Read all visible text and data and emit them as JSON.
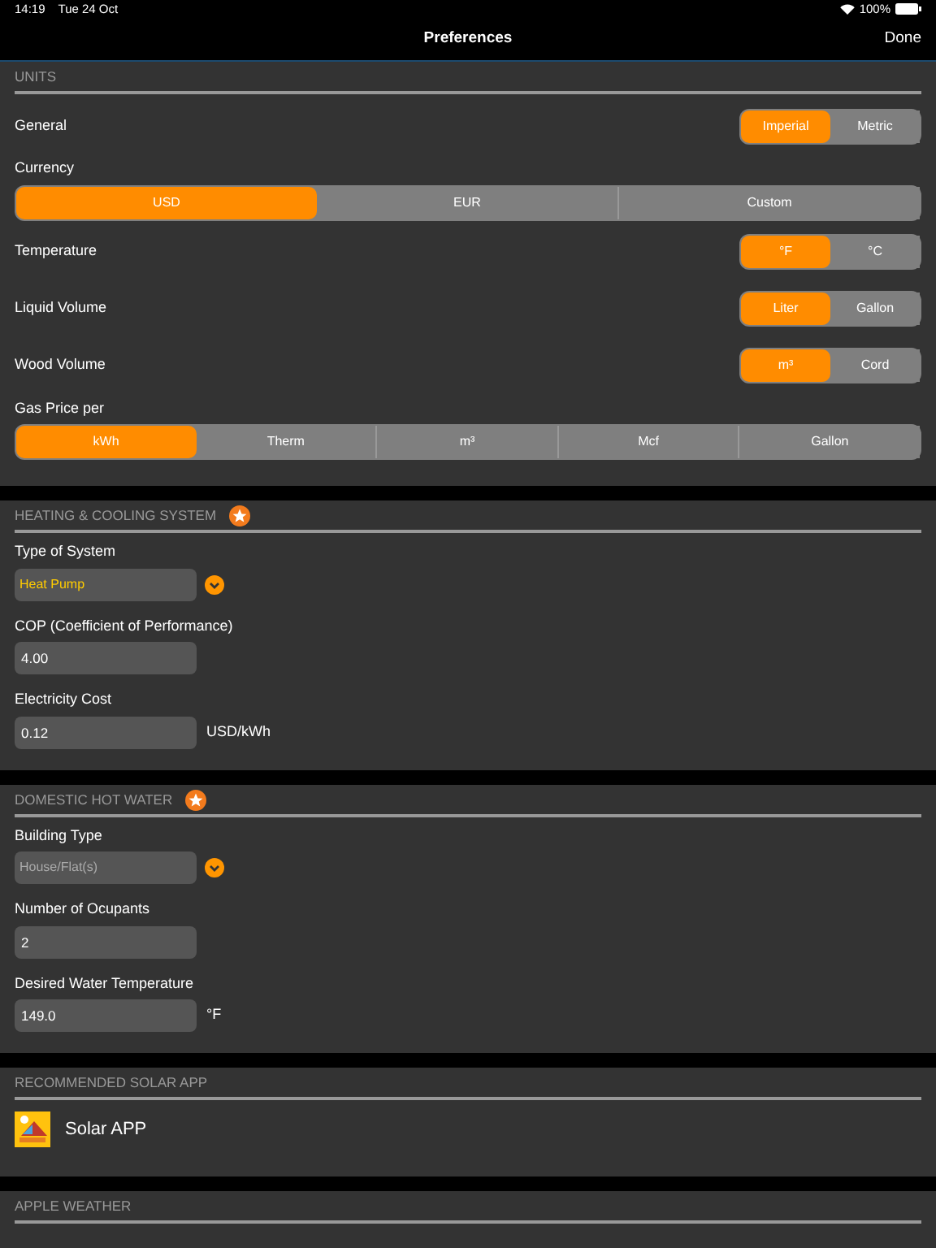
{
  "status_bar": {
    "time": "14:19",
    "date": "Tue 24 Oct",
    "battery": "100%"
  },
  "nav": {
    "title": "Preferences",
    "done": "Done"
  },
  "sections": [
    {
      "title": "UNITS",
      "star": false,
      "rows": [
        {
          "kind": "segment-inline",
          "label": "General",
          "options": [
            {
              "label": "Imperial",
              "selected": true
            },
            {
              "label": "Metric",
              "selected": false
            }
          ]
        },
        {
          "kind": "segment-full",
          "label": "Currency",
          "options": [
            {
              "label": "USD",
              "selected": true
            },
            {
              "label": "EUR",
              "selected": false
            },
            {
              "label": "Custom",
              "selected": false
            }
          ]
        },
        {
          "kind": "segment-inline",
          "label": "Temperature",
          "options": [
            {
              "label": "°F",
              "selected": true
            },
            {
              "label": "°C",
              "selected": false
            }
          ]
        },
        {
          "kind": "segment-inline",
          "label": "Liquid Volume",
          "options": [
            {
              "label": "Liter",
              "selected": true
            },
            {
              "label": "Gallon",
              "selected": false
            }
          ]
        },
        {
          "kind": "segment-inline",
          "label": "Wood Volume",
          "options": [
            {
              "label": "m³",
              "selected": true
            },
            {
              "label": "Cord",
              "selected": false
            }
          ]
        },
        {
          "kind": "segment-full",
          "label": "Gas Price per",
          "options": [
            {
              "label": "kWh",
              "selected": true
            },
            {
              "label": "Therm",
              "selected": false
            },
            {
              "label": "m³",
              "selected": false
            },
            {
              "label": "Mcf",
              "selected": false
            },
            {
              "label": "Gallon",
              "selected": false
            }
          ]
        }
      ]
    },
    {
      "title": "HEATING & COOLING SYSTEM",
      "star": true,
      "rows": [
        {
          "kind": "dropdown",
          "label": "Type of System",
          "value": "Heat Pump",
          "disabled": false
        },
        {
          "kind": "input",
          "label": "COP (Coefficient of Performance)",
          "value": "4.00"
        },
        {
          "kind": "input",
          "label": "Electricity Cost",
          "value": "0.12",
          "unit": "USD/kWh"
        }
      ]
    },
    {
      "title": "DOMESTIC HOT WATER",
      "star": true,
      "rows": [
        {
          "kind": "dropdown",
          "label": "Building Type",
          "value": "House/Flat(s)",
          "disabled": true
        },
        {
          "kind": "input",
          "label": "Number of Ocupants",
          "value": "2"
        },
        {
          "kind": "input",
          "label": "Desired Water Temperature",
          "value": "149.0",
          "unit": "°F"
        }
      ]
    },
    {
      "title": "RECOMMENDED SOLAR APP",
      "star": false,
      "rows": [
        {
          "kind": "app",
          "label": "Solar APP"
        }
      ]
    },
    {
      "title": "APPLE WEATHER",
      "star": false
    }
  ]
}
